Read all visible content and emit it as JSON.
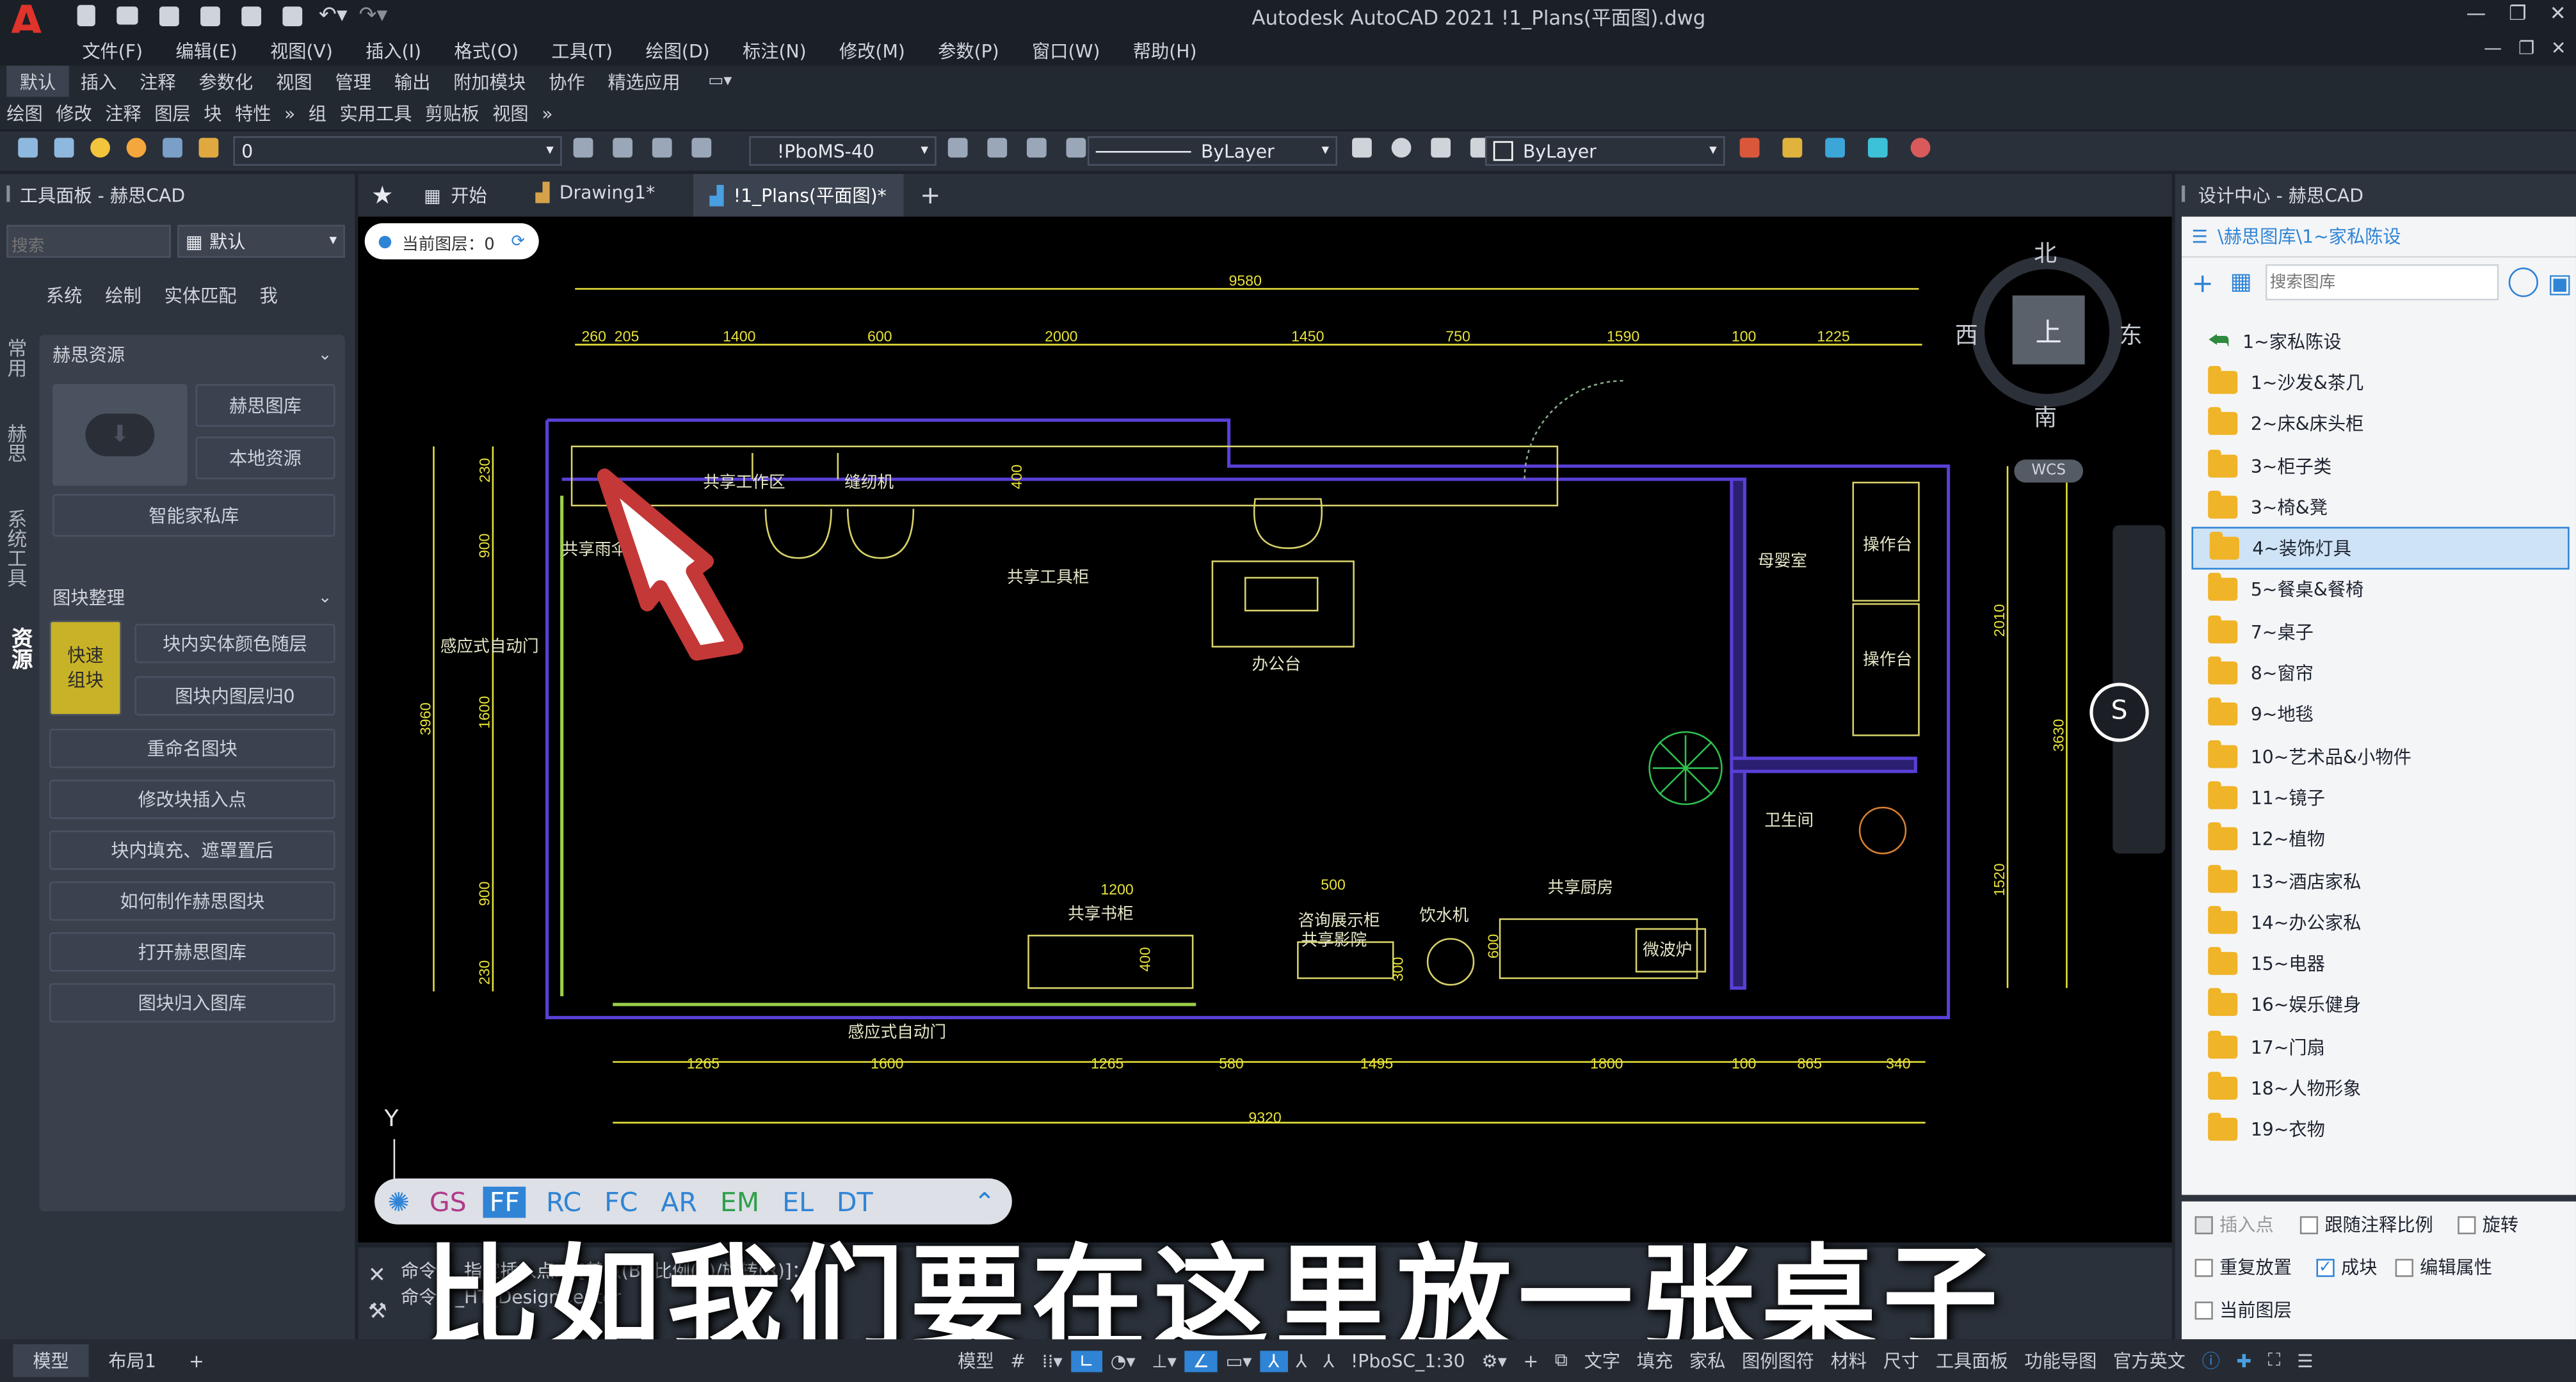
{
  "window": {
    "title": "Autodesk AutoCAD 2021   !1_Plans(平面图).dwg",
    "controls": [
      "—",
      "❐",
      "✕"
    ]
  },
  "menu": [
    "文件(F)",
    "编辑(E)",
    "视图(V)",
    "插入(I)",
    "格式(O)",
    "工具(T)",
    "绘图(D)",
    "标注(N)",
    "修改(M)",
    "参数(P)",
    "窗口(W)",
    "帮助(H)"
  ],
  "ribbon_tabs": [
    "默认",
    "插入",
    "注释",
    "参数化",
    "视图",
    "管理",
    "输出",
    "附加模块",
    "协作",
    "精选应用"
  ],
  "ribbon_panels": [
    "绘图",
    "修改",
    "注释",
    "图层",
    "块",
    "特性",
    "组",
    "实用工具",
    "剪贴板",
    "视图"
  ],
  "toolbar": {
    "layer_value": "0",
    "style_value": "!PboMS-40",
    "linetype_value": "ByLayer",
    "color_value": "ByLayer"
  },
  "doc_tabs": [
    "开始",
    "Drawing1*",
    "!1_Plans(平面图)*"
  ],
  "left_panel": {
    "title": "工具面板 - 赫思CAD",
    "search_placeholder": "搜索",
    "default_label": "默认",
    "subtabs": [
      "系统",
      "绘制",
      "实体匹配",
      "我"
    ],
    "vertical_tabs": [
      "常用",
      "赫思",
      "系统工具",
      "资源"
    ],
    "section1": {
      "title": "赫思资源",
      "buttons": [
        "赫思图库",
        "本地资源",
        "智能家私库"
      ]
    },
    "section2": {
      "title": "图块整理",
      "quick": "快速组块",
      "buttons": [
        "块内实体颜色随层",
        "图块内图层归0",
        "重命名图块",
        "修改块插入点",
        "块内填充、遮罩置后",
        "如何制作赫思图块",
        "打开赫思图库",
        "图块归入图库"
      ]
    }
  },
  "canvas": {
    "layer_chip": "当前图层：0",
    "compass": {
      "north": "北",
      "south": "南",
      "east": "东",
      "west": "西",
      "top": "上",
      "wcs": "WCS"
    },
    "y_axis": "Y",
    "dims_top": {
      "total": "9580",
      "segments": [
        "260",
        "205",
        "1400",
        "600",
        "2000",
        "1450",
        "750",
        "1590",
        "100",
        "1225"
      ]
    },
    "dims_bottom": {
      "total": "9320",
      "segments": [
        "1265",
        "1600",
        "1265",
        "580",
        "1495",
        "1800",
        "100",
        "865",
        "340"
      ]
    },
    "dims_left": {
      "total": "3960",
      "segments": [
        "230",
        "900",
        "1600",
        "900",
        "230"
      ]
    },
    "dims_right": {
      "total": "3630",
      "segments": [
        "2010",
        "1520"
      ]
    },
    "dims_inner": [
      "400",
      "1200",
      "400",
      "500",
      "300",
      "600"
    ],
    "rooms": [
      "共享工作区",
      "缝纫机",
      "共享雨伞",
      "共享工具柜",
      "办公台",
      "母婴室",
      "操作台",
      "操作台",
      "感应式自动门",
      "卫生间",
      "共享书柜",
      "咨询展示柜",
      "共享影院",
      "饮水机",
      "共享厨房",
      "微波炉",
      "感应式自动门"
    ],
    "quick_bar": [
      "GS",
      "FF",
      "RC",
      "FC",
      "AR",
      "EM",
      "EL",
      "DT"
    ]
  },
  "command": {
    "lines": [
      "命令：_指定插入点或 [基点(B)/比例(S)/旋转(R)]：",
      "命令：_HT_DesignCenter"
    ]
  },
  "subtitle": "比如我们要在这里放一张桌子",
  "design_center": {
    "title": "设计中心 - 赫思CAD",
    "path": "\\赫思图库\\1~家私陈设",
    "search_placeholder": "搜索图库",
    "items": [
      "1~家私陈设",
      "1~沙发&茶几",
      "2~床&床头柜",
      "3~柜子类",
      "3~椅&凳",
      "4~装饰灯具",
      "5~餐桌&餐椅",
      "7~桌子",
      "8~窗帘",
      "9~地毯",
      "10~艺术品&小物件",
      "11~镜子",
      "12~植物",
      "13~酒店家私",
      "14~办公家私",
      "15~电器",
      "16~娱乐健身",
      "17~门扇",
      "18~人物形象",
      "19~衣物"
    ],
    "options": [
      "插入点",
      "跟随注释比例",
      "旋转",
      "重复放置",
      "成块",
      "编辑属性",
      "当前图层"
    ]
  },
  "layout_tabs": [
    "模型",
    "布局1",
    "+"
  ],
  "statusbar": [
    "模型",
    "!PboSC_1:30",
    "文字",
    "填充",
    "家私",
    "图例图符",
    "材料",
    "尺寸",
    "工具面板",
    "功能导图",
    "官方英文"
  ],
  "colors": {
    "bg": "#1e232b",
    "canvas": "#000000",
    "dim": "#e8e23a",
    "wall": "#5a3fd6",
    "furniture": "#d8d26a",
    "highlight": "#2f84d6",
    "folder": "#f0b429",
    "accent": "#d9c13a"
  }
}
